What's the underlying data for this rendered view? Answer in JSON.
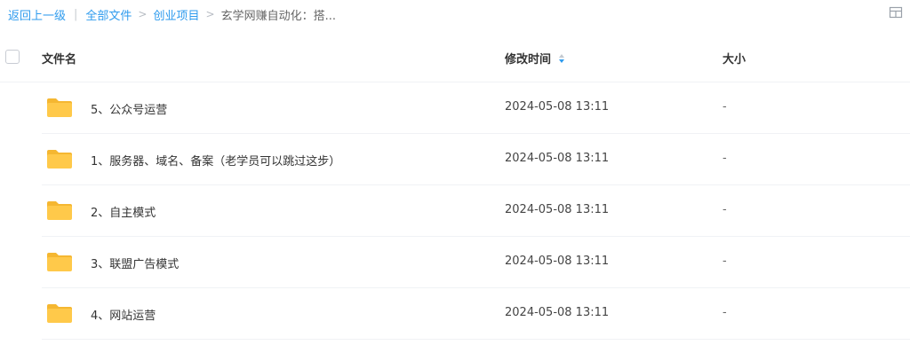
{
  "breadcrumb": {
    "back": "返回上一级",
    "all_files": "全部文件",
    "parent": "创业项目",
    "current": "玄学网赚自动化：搭..."
  },
  "separators": {
    "bar": "|",
    "gt": ">"
  },
  "view_toggle_icon": "grid-icon",
  "table": {
    "headers": {
      "name": "文件名",
      "modified": "修改时间",
      "size": "大小"
    },
    "sort_icon": "sort-updown-icon",
    "rows": [
      {
        "name": "5、公众号运营",
        "modified": "2024-05-08 13:11",
        "size": "-"
      },
      {
        "name": "1、服务器、域名、备案（老学员可以跳过这步）",
        "modified": "2024-05-08 13:11",
        "size": "-"
      },
      {
        "name": "2、自主模式",
        "modified": "2024-05-08 13:11",
        "size": "-"
      },
      {
        "name": "3、联盟广告模式",
        "modified": "2024-05-08 13:11",
        "size": "-"
      },
      {
        "name": "4、网站运营",
        "modified": "2024-05-08 13:11",
        "size": "-"
      }
    ]
  },
  "colors": {
    "link": "#2e9bee",
    "folder": "#ffc94a",
    "folder_tab": "#f5b731"
  }
}
